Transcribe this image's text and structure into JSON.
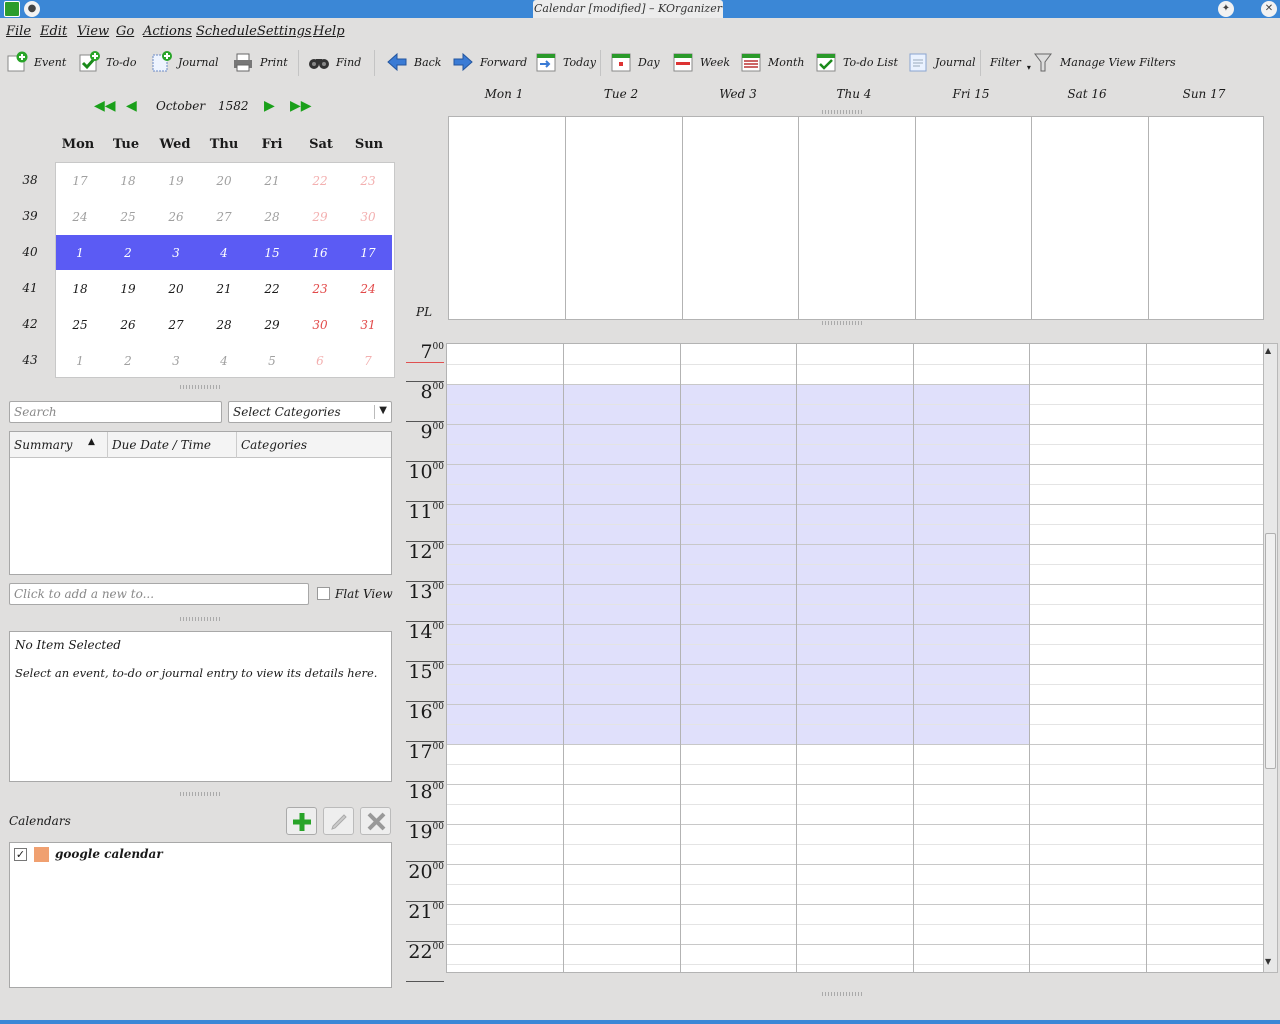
{
  "window": {
    "title": "Calendar [modified] – KOrganizer"
  },
  "menu": [
    "File",
    "Edit",
    "View",
    "Go",
    "Actions",
    "Schedule",
    "Settings",
    "Help"
  ],
  "toolbar": {
    "event": "Event",
    "todo": "To-do",
    "journal": "Journal",
    "print": "Print",
    "find": "Find",
    "back": "Back",
    "forward": "Forward",
    "today": "Today",
    "day": "Day",
    "week": "Week",
    "month": "Month",
    "todo_list": "To-do List",
    "journal_view": "Journal",
    "filter": "Filter",
    "manage_filters": "Manage View Filters"
  },
  "date_nav": {
    "month": "October",
    "year": "1582"
  },
  "mini_calendar": {
    "weekdays": [
      "Mon",
      "Tue",
      "Wed",
      "Thu",
      "Fri",
      "Sat",
      "Sun"
    ],
    "weeks": [
      {
        "num": "38",
        "days": [
          "17",
          "18",
          "19",
          "20",
          "21",
          "22",
          "23"
        ]
      },
      {
        "num": "39",
        "days": [
          "24",
          "25",
          "26",
          "27",
          "28",
          "29",
          "30"
        ]
      },
      {
        "num": "40",
        "days": [
          "1",
          "2",
          "3",
          "4",
          "15",
          "16",
          "17"
        ]
      },
      {
        "num": "41",
        "days": [
          "18",
          "19",
          "20",
          "21",
          "22",
          "23",
          "24"
        ]
      },
      {
        "num": "42",
        "days": [
          "25",
          "26",
          "27",
          "28",
          "29",
          "30",
          "31"
        ]
      },
      {
        "num": "43",
        "days": [
          "1",
          "2",
          "3",
          "4",
          "5",
          "6",
          "7"
        ]
      }
    ]
  },
  "todo": {
    "search_placeholder": "Search",
    "category_select": "Select Categories",
    "columns": [
      "Summary",
      "Due Date / Time",
      "Categories"
    ],
    "add_placeholder": "Click to add a new to...",
    "flat_view": "Flat View"
  },
  "details": {
    "heading": "No Item Selected",
    "body": "Select an event, to-do or journal entry to view its details here."
  },
  "calendars": {
    "label": "Calendars",
    "items": [
      {
        "name": "google calendar",
        "color": "#f0a070",
        "checked": true
      }
    ]
  },
  "agenda": {
    "days": [
      "Mon 1",
      "Tue 2",
      "Wed 3",
      "Thu 4",
      "Fri 15",
      "Sat 16",
      "Sun 17"
    ],
    "timezone": "PL",
    "hours": [
      "7",
      "8",
      "9",
      "10",
      "11",
      "12",
      "13",
      "14",
      "15",
      "16",
      "17",
      "18",
      "19",
      "20",
      "21",
      "22"
    ],
    "minutes_suffix": "00",
    "work_hours_color": "#e0e0fb",
    "now_line_color": "#e05050"
  }
}
